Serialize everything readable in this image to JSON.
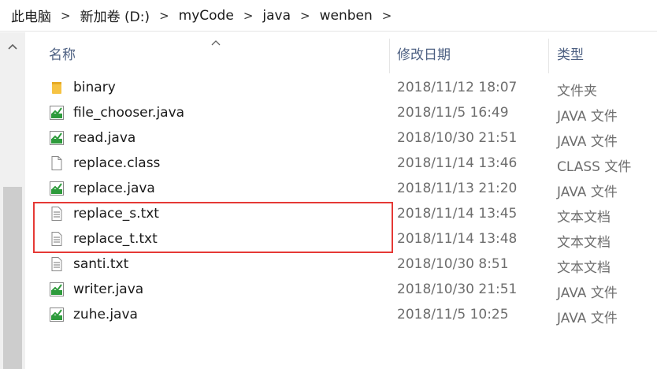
{
  "breadcrumb": [
    "此电脑",
    "新加卷 (D:)",
    "myCode",
    "java",
    "wenben"
  ],
  "columns": {
    "name": "名称",
    "date": "修改日期",
    "type": "类型"
  },
  "files": [
    {
      "name": "binary",
      "date": "2018/11/12 18:07",
      "type": "文件夹",
      "icon": "folder-icon"
    },
    {
      "name": "file_chooser.java",
      "date": "2018/11/5 16:49",
      "type": "JAVA 文件",
      "icon": "java-file-icon"
    },
    {
      "name": "read.java",
      "date": "2018/10/30 21:51",
      "type": "JAVA 文件",
      "icon": "java-file-icon"
    },
    {
      "name": "replace.class",
      "date": "2018/11/14 13:46",
      "type": "CLASS 文件",
      "icon": "blank-file-icon"
    },
    {
      "name": "replace.java",
      "date": "2018/11/13 21:20",
      "type": "JAVA 文件",
      "icon": "java-file-icon"
    },
    {
      "name": "replace_s.txt",
      "date": "2018/11/14 13:45",
      "type": "文本文档",
      "icon": "text-file-icon"
    },
    {
      "name": "replace_t.txt",
      "date": "2018/11/14 13:48",
      "type": "文本文档",
      "icon": "text-file-icon"
    },
    {
      "name": "santi.txt",
      "date": "2018/10/30 8:51",
      "type": "文本文档",
      "icon": "text-file-icon"
    },
    {
      "name": "writer.java",
      "date": "2018/10/30 21:51",
      "type": "JAVA 文件",
      "icon": "java-file-icon"
    },
    {
      "name": "zuhe.java",
      "date": "2018/11/5 10:25",
      "type": "JAVA 文件",
      "icon": "java-file-icon"
    }
  ],
  "colors": {
    "highlight": "#e53935",
    "header_text": "#4d6082",
    "folder": "#f6c343",
    "java_green": "#2e9b3c"
  }
}
